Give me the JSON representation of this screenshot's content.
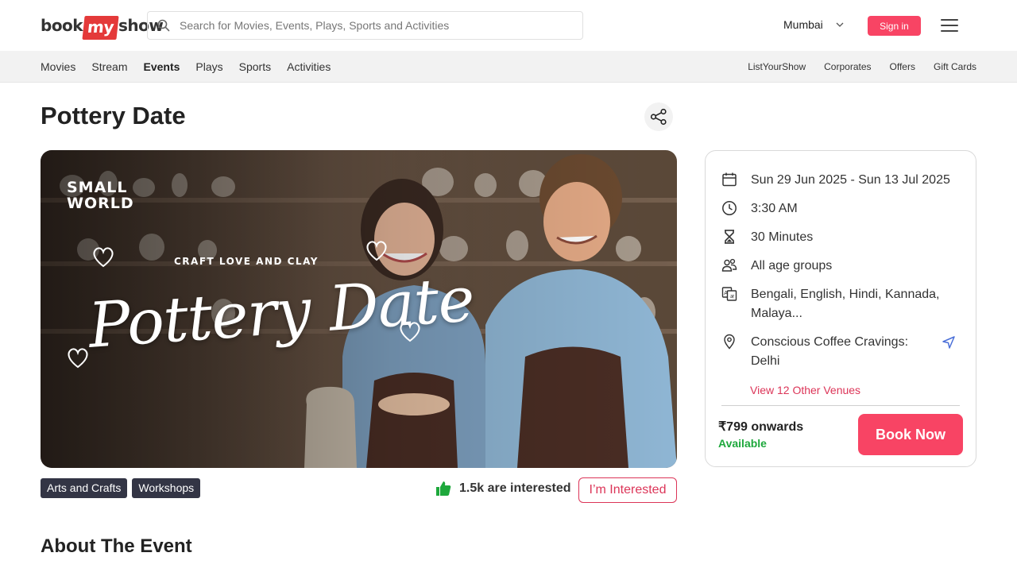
{
  "header": {
    "logo": {
      "pre": "book",
      "mid": "my",
      "post": "show"
    },
    "search_placeholder": "Search for Movies, Events, Plays, Sports and Activities",
    "city": "Mumbai",
    "signin_label": "Sign in"
  },
  "nav": {
    "left": [
      "Movies",
      "Stream",
      "Events",
      "Plays",
      "Sports",
      "Activities"
    ],
    "active": "Events",
    "right": [
      "ListYourShow",
      "Corporates",
      "Offers",
      "Gift Cards"
    ]
  },
  "event": {
    "title": "Pottery Date",
    "banner": {
      "brand_line1": "SMALL",
      "brand_line2": "WORLD",
      "tagline": "CRAFT LOVE AND CLAY",
      "script_title": "Pottery Date"
    },
    "tags": [
      "Arts and Crafts",
      "Workshops"
    ],
    "interested_count": "1.5k are interested",
    "interested_button": "I’m Interested"
  },
  "details": {
    "dates": "Sun 29 Jun 2025 - Sun 13 Jul 2025",
    "time": "3:30 AM",
    "duration": "30 Minutes",
    "age": "All age groups",
    "languages_line1": "Bengali, English, Hindi, Kannada,",
    "languages_line2": "Malaya...",
    "venue_line1": "Conscious Coffee Cravings:",
    "venue_line2": "Delhi",
    "other_venues": "View 12 Other Venues",
    "price": "₹799 onwards",
    "availability": "Available",
    "book_label": "Book Now"
  },
  "about_heading": "About The Event",
  "colors": {
    "brand_red": "#f84464",
    "accent_pink": "#dc3558",
    "tag_bg": "#333545",
    "available_green": "#1ea83c"
  }
}
